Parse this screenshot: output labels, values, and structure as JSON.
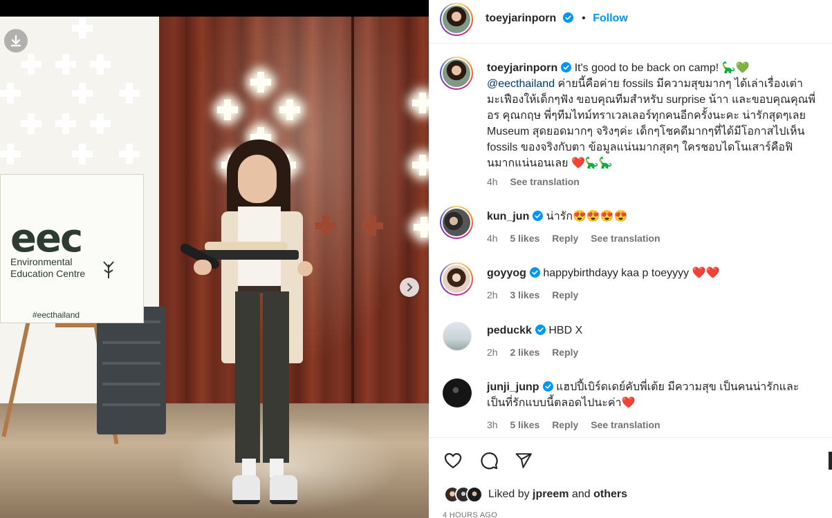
{
  "post": {
    "author": "toeyjarinporn",
    "header_separator": "•",
    "follow_label": "Follow"
  },
  "photo": {
    "sign_logo": "eec",
    "sign_line1": "Environmental",
    "sign_line2": "Education Centre",
    "sign_hashtag": "#eecthailand"
  },
  "caption": {
    "author": "toeyjarinporn",
    "line1_text": "It's good to be back on camp! 🦕💚",
    "mention": "@eecthailand",
    "body": "ค่ายนี้คือค่าย fossils มีความสุขมากๆ ได้เล่าเรื่องเต่ามะเฟืองให้เด็กๆฟัง ขอบคุณทีมสำหรับ surprise น้าา และขอบคุณคุณพี่อร คุณกฤษ พี่ๆทีมไทม์ทราเวลเลอร์ทุกคนอีกครั้งนะคะ น่ารักสุดๆเลย Museum สุดยอดมากๆ จริงๆค่ะ เด็กๆโชคดีมากๆที่ได้มีโอกาสไปเห็น fossils ของจริงกับตา ข้อมูลแน่นมากสุดๆ ใครชอบไดโนเสาร์คือฟินมากแน่นอนเลย ❤️🦕🦕",
    "time": "4h",
    "see_translation": "See translation"
  },
  "comments": [
    {
      "user": "kun_jun",
      "text": "น่ารัก😍😍😍😍",
      "time": "4h",
      "likes": "5 likes",
      "reply": "Reply",
      "see_translation": "See translation"
    },
    {
      "user": "goyyog",
      "text": "happybirthdayy kaa p toeyyyy ❤️❤️",
      "time": "2h",
      "likes": "3 likes",
      "reply": "Reply"
    },
    {
      "user": "peduckk",
      "text": "HBD X",
      "time": "2h",
      "likes": "2 likes",
      "reply": "Reply"
    },
    {
      "user": "junji_junp",
      "text": "แฮปปี้เบิร์ดเดย์คับพี่เต้ย มีความสุข เป็นคนน่ารักและเป็นที่รักแบบนี้ตลอดไปนะค่า❤️",
      "time": "3h",
      "likes": "5 likes",
      "reply": "Reply",
      "see_translation": "See translation"
    }
  ],
  "footer": {
    "liked_prefix": "Liked by",
    "liked_user": "jpreem",
    "liked_and": "and",
    "liked_others": "others",
    "time_ago": "4 HOURS AGO"
  },
  "icons": {
    "download": "download-icon",
    "next": "chevron-right-icon",
    "heart": "heart-icon",
    "comment": "comment-icon",
    "share": "share-icon",
    "verified": "verified-badge-icon"
  },
  "colors": {
    "accent": "#0095f6",
    "text": "#262626",
    "muted": "#737373"
  }
}
